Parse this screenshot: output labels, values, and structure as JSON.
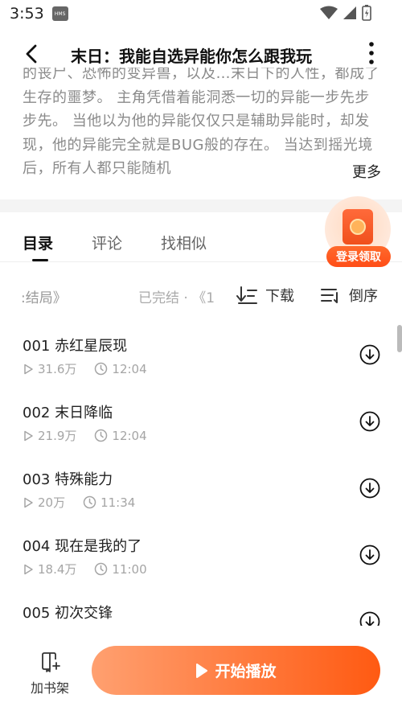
{
  "status_bar": {
    "time": "3:53",
    "hms_badge": "HMS"
  },
  "header": {
    "title": "末日：我能自选异能你怎么跟我玩"
  },
  "description": {
    "text": "的丧尸、恐怖的变异兽，以及…末日下的人性，都成了生存的噩梦。 主角凭借着能洞悉一切的异能一步先步步先。 当他以为他的异能仅仅只是辅助异能时，却发现，他的异能完全就是BUG般的存在。 当达到摇光境后，所有人都只能随机",
    "more_label": "更多"
  },
  "tabs": [
    {
      "label": "目录",
      "active": true
    },
    {
      "label": "评论",
      "active": false
    },
    {
      "label": "找相似",
      "active": false
    }
  ],
  "promo": {
    "label": "登录领取"
  },
  "list_toolbar": {
    "left_text": ":结局》",
    "status_text": "已完结 · 《1",
    "download_label": "下载",
    "sort_label": "倒序"
  },
  "episodes": [
    {
      "title": "001 赤红星辰现",
      "plays": "31.6万",
      "duration": "12:04"
    },
    {
      "title": "002 末日降临",
      "plays": "21.9万",
      "duration": "12:04"
    },
    {
      "title": "003 特殊能力",
      "plays": "20万",
      "duration": "11:34"
    },
    {
      "title": "004 现在是我的了",
      "plays": "18.4万",
      "duration": "11:00"
    },
    {
      "title": "005 初次交锋",
      "plays": "",
      "duration": ""
    }
  ],
  "bottom_bar": {
    "shelf_label": "加书架",
    "play_label": "开始播放"
  },
  "colors": {
    "accent_start": "#ffa070",
    "accent_end": "#ff5a12",
    "promo_red": "#ff4d17"
  }
}
